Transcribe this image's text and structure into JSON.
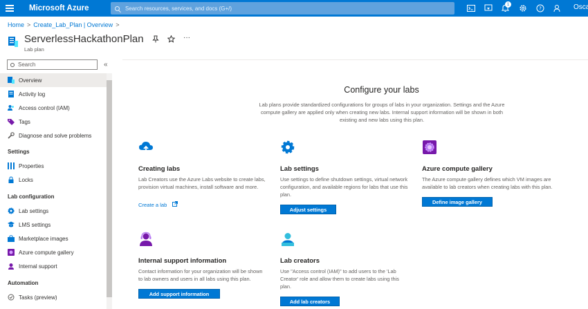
{
  "topbar": {
    "brand": "Microsoft Azure",
    "search_placeholder": "Search resources, services, and docs (G+/)",
    "notification_count": "1",
    "user": "Oscar",
    "icons": [
      "cloud-shell-icon",
      "directory-filter-icon",
      "notifications-icon",
      "settings-icon",
      "help-icon",
      "feedback-icon"
    ]
  },
  "breadcrumb": {
    "home": "Home",
    "parent": "Create_Lab_Plan | Overview",
    "separator": ">"
  },
  "resource": {
    "title": "ServerlessHackathonPlan",
    "subtitle": "Lab plan"
  },
  "sidebar": {
    "search_placeholder": "Search",
    "collapse": "«",
    "items": [
      {
        "label": "Overview",
        "icon": "overview-icon",
        "active": true
      },
      {
        "label": "Activity log",
        "icon": "activity-log-icon"
      },
      {
        "label": "Access control (IAM)",
        "icon": "people-icon"
      },
      {
        "label": "Tags",
        "icon": "tag-icon"
      },
      {
        "label": "Diagnose and solve problems",
        "icon": "wrench-icon"
      }
    ],
    "settings_header": "Settings",
    "settings_items": [
      {
        "label": "Properties",
        "icon": "properties-icon"
      },
      {
        "label": "Locks",
        "icon": "lock-icon"
      }
    ],
    "labconfig_header": "Lab configuration",
    "labconfig_items": [
      {
        "label": "Lab settings",
        "icon": "gear-icon"
      },
      {
        "label": "LMS settings",
        "icon": "lms-icon"
      },
      {
        "label": "Marketplace images",
        "icon": "marketplace-icon"
      },
      {
        "label": "Azure compute gallery",
        "icon": "gallery-icon"
      },
      {
        "label": "Internal support",
        "icon": "support-icon"
      }
    ],
    "automation_header": "Automation",
    "automation_items": [
      {
        "label": "Tasks (preview)",
        "icon": "tasks-icon"
      }
    ]
  },
  "main": {
    "title": "Configure your labs",
    "description": "Lab plans provide standardized configurations for groups of labs in your organization. Settings and the Azure compute gallery are applied only when creating new labs. Internal support information will be shown in both existing and new labs using this plan.",
    "cards": [
      {
        "title": "Creating labs",
        "text": "Lab Creators use the Azure Labs website to create labs, provision virtual machines, install software and more.",
        "link": "Create a lab",
        "icon": "cloud-upload-icon"
      },
      {
        "title": "Lab settings",
        "text": "Use settings to define shutdown settings, virtual network configuration, and available regions for labs that use this plan.",
        "button": "Adjust settings",
        "icon": "gear-icon"
      },
      {
        "title": "Azure compute gallery",
        "text": "The Azure compute gallery defines which VM images are available to lab creators when creating labs with this plan.",
        "button": "Define image gallery",
        "icon": "gallery-icon"
      },
      {
        "title": "Internal support information",
        "text": "Contact information for your organization will be shown to lab owners and users in all labs using this plan.",
        "button": "Add support information",
        "icon": "support-person-icon"
      },
      {
        "title": "Lab creators",
        "text": "Use \"Access control (IAM)\" to add users to the 'Lab Creator' role and allow them to create labs using this plan.",
        "button": "Add lab creators",
        "icon": "user-icon"
      }
    ]
  },
  "colors": {
    "accent": "#0078d4",
    "purple": "#7719aa",
    "teal": "#32bedd"
  }
}
